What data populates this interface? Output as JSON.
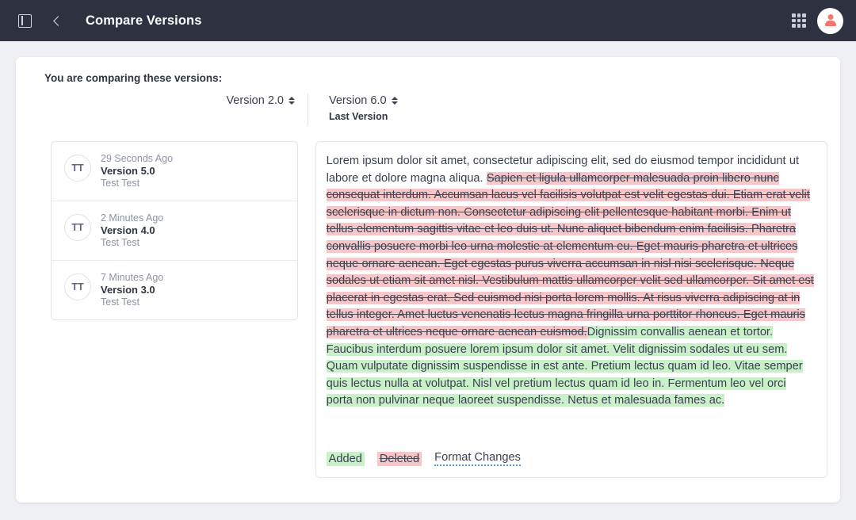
{
  "topbar": {
    "panel_toggle_icon": "sidebar-panel-icon",
    "back_icon": "chevron-left-icon",
    "title": "Compare Versions",
    "apps_icon": "apps-grid-icon",
    "avatar_icon": "user-avatar-icon"
  },
  "compare": {
    "label": "You are comparing these versions:",
    "left": {
      "value": "Version 2.0",
      "sublabel": ""
    },
    "right": {
      "value": "Version 6.0",
      "sublabel": "Last Version"
    }
  },
  "versions": [
    {
      "initials": "TT",
      "time": "29 Seconds Ago",
      "name": "Version 5.0",
      "user": "Test Test"
    },
    {
      "initials": "TT",
      "time": "2 Minutes Ago",
      "name": "Version 4.0",
      "user": "Test Test"
    },
    {
      "initials": "TT",
      "time": "7 Minutes Ago",
      "name": "Version 3.0",
      "user": "Test Test"
    }
  ],
  "diff": {
    "unchanged_lead": "Lorem ipsum dolor sit amet, consectetur adipiscing elit, sed do eiusmod tempor incididunt ut labore et dolore magna aliqua. ",
    "deleted": "Sapien et ligula ullamcorper malesuada proin libero nunc consequat interdum. Accumsan lacus vel facilisis volutpat est velit egestas dui. Etiam erat velit scelerisque in dictum non. Consectetur adipiscing elit pellentesque habitant morbi. Enim ut tellus elementum sagittis vitae et leo duis ut. Nunc aliquet bibendum enim facilisis. Pharetra convallis posuere morbi leo urna molestie at elementum eu. Eget mauris pharetra et ultrices neque ornare aenean. Eget egestas purus viverra accumsan in nisl nisi scelerisque. Neque sodales ut etiam sit amet nisl. Vestibulum mattis ullamcorper velit sed ullamcorper. Sit amet est placerat in egestas erat. Sed euismod nisi porta lorem mollis. At risus viverra adipiscing at in tellus integer. Amet luctus venenatis lectus magna fringilla urna porttitor rhoncus. Eget mauris pharetra et ultrices neque ornare aenean euismod.",
    "added": "Dignissim convallis aenean et tortor. Faucibus interdum posuere lorem ipsum dolor sit amet. Velit dignissim sodales ut eu sem. Quam vulputate dignissim suspendisse in est ante. Pretium lectus quam id leo. Vitae semper quis lectus nulla at volutpat. Nisl vel pretium lectus quam id leo in. Fermentum leo vel orci porta non pulvinar neque laoreet suspendisse. Netus et malesuada fames ac."
  },
  "legend": {
    "added": "Added",
    "deleted": "Deleted",
    "format_changes": "Format Changes"
  },
  "colors": {
    "topbar": "#2e3240",
    "page_bg": "#eff0f4",
    "added_bg": "#caf0ca",
    "deleted_bg": "#f7c6c9",
    "format_underline": "#5b9bd5",
    "avatar_person": "#f4756b"
  }
}
